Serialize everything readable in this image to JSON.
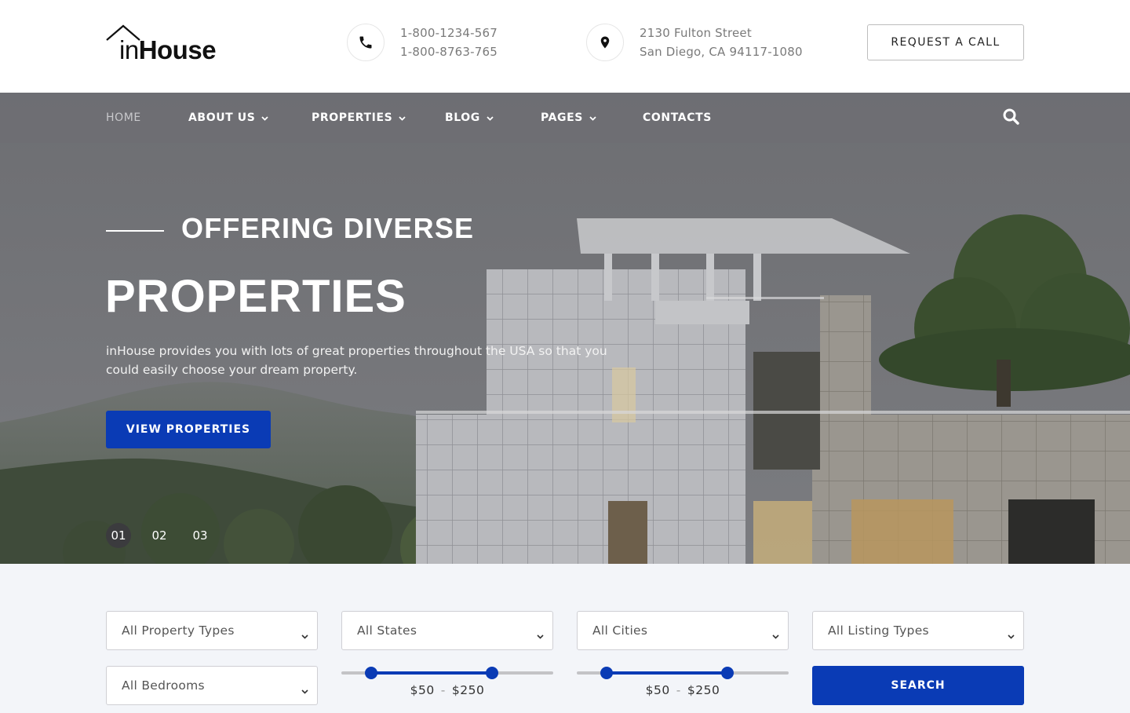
{
  "brand": {
    "logo_in": "in",
    "logo_house": "House"
  },
  "contact": {
    "phones": [
      "1-800-1234-567",
      "1-800-8763-765"
    ],
    "address": [
      "2130 Fulton Street",
      "San Diego, CA 94117-1080"
    ]
  },
  "header": {
    "request_call_label": "REQUEST A CALL"
  },
  "nav": {
    "items": [
      {
        "label": "HOME",
        "active": true,
        "dropdown": false
      },
      {
        "label": "ABOUT US",
        "active": false,
        "dropdown": true
      },
      {
        "label": "PROPERTIES",
        "active": false,
        "dropdown": true
      },
      {
        "label": "BLOG",
        "active": false,
        "dropdown": true
      },
      {
        "label": "PAGES",
        "active": false,
        "dropdown": true
      },
      {
        "label": "CONTACTS",
        "active": false,
        "dropdown": false
      }
    ],
    "search_icon": "search-icon"
  },
  "hero": {
    "subtitle": "OFFERING DIVERSE",
    "title": "PROPERTIES",
    "description": "inHouse provides you with lots of great properties throughout the USA so that you could easily choose your dream property.",
    "cta_label": "VIEW PROPERTIES",
    "slides": [
      "01",
      "02",
      "03"
    ],
    "active_slide": 0
  },
  "search": {
    "property_type": "All Property Types",
    "state": "All States",
    "city": "All Cities",
    "listing_type": "All Listing Types",
    "bedrooms": "All Bedrooms",
    "range_1": {
      "min_label": "$50",
      "max_label": "$250"
    },
    "range_2": {
      "min_label": "$50",
      "max_label": "$250"
    },
    "search_label": "SEARCH"
  },
  "colors": {
    "accent": "#0a3bb5",
    "nav_bg": "#6e6e73",
    "page_bg": "#f3f5f9"
  }
}
